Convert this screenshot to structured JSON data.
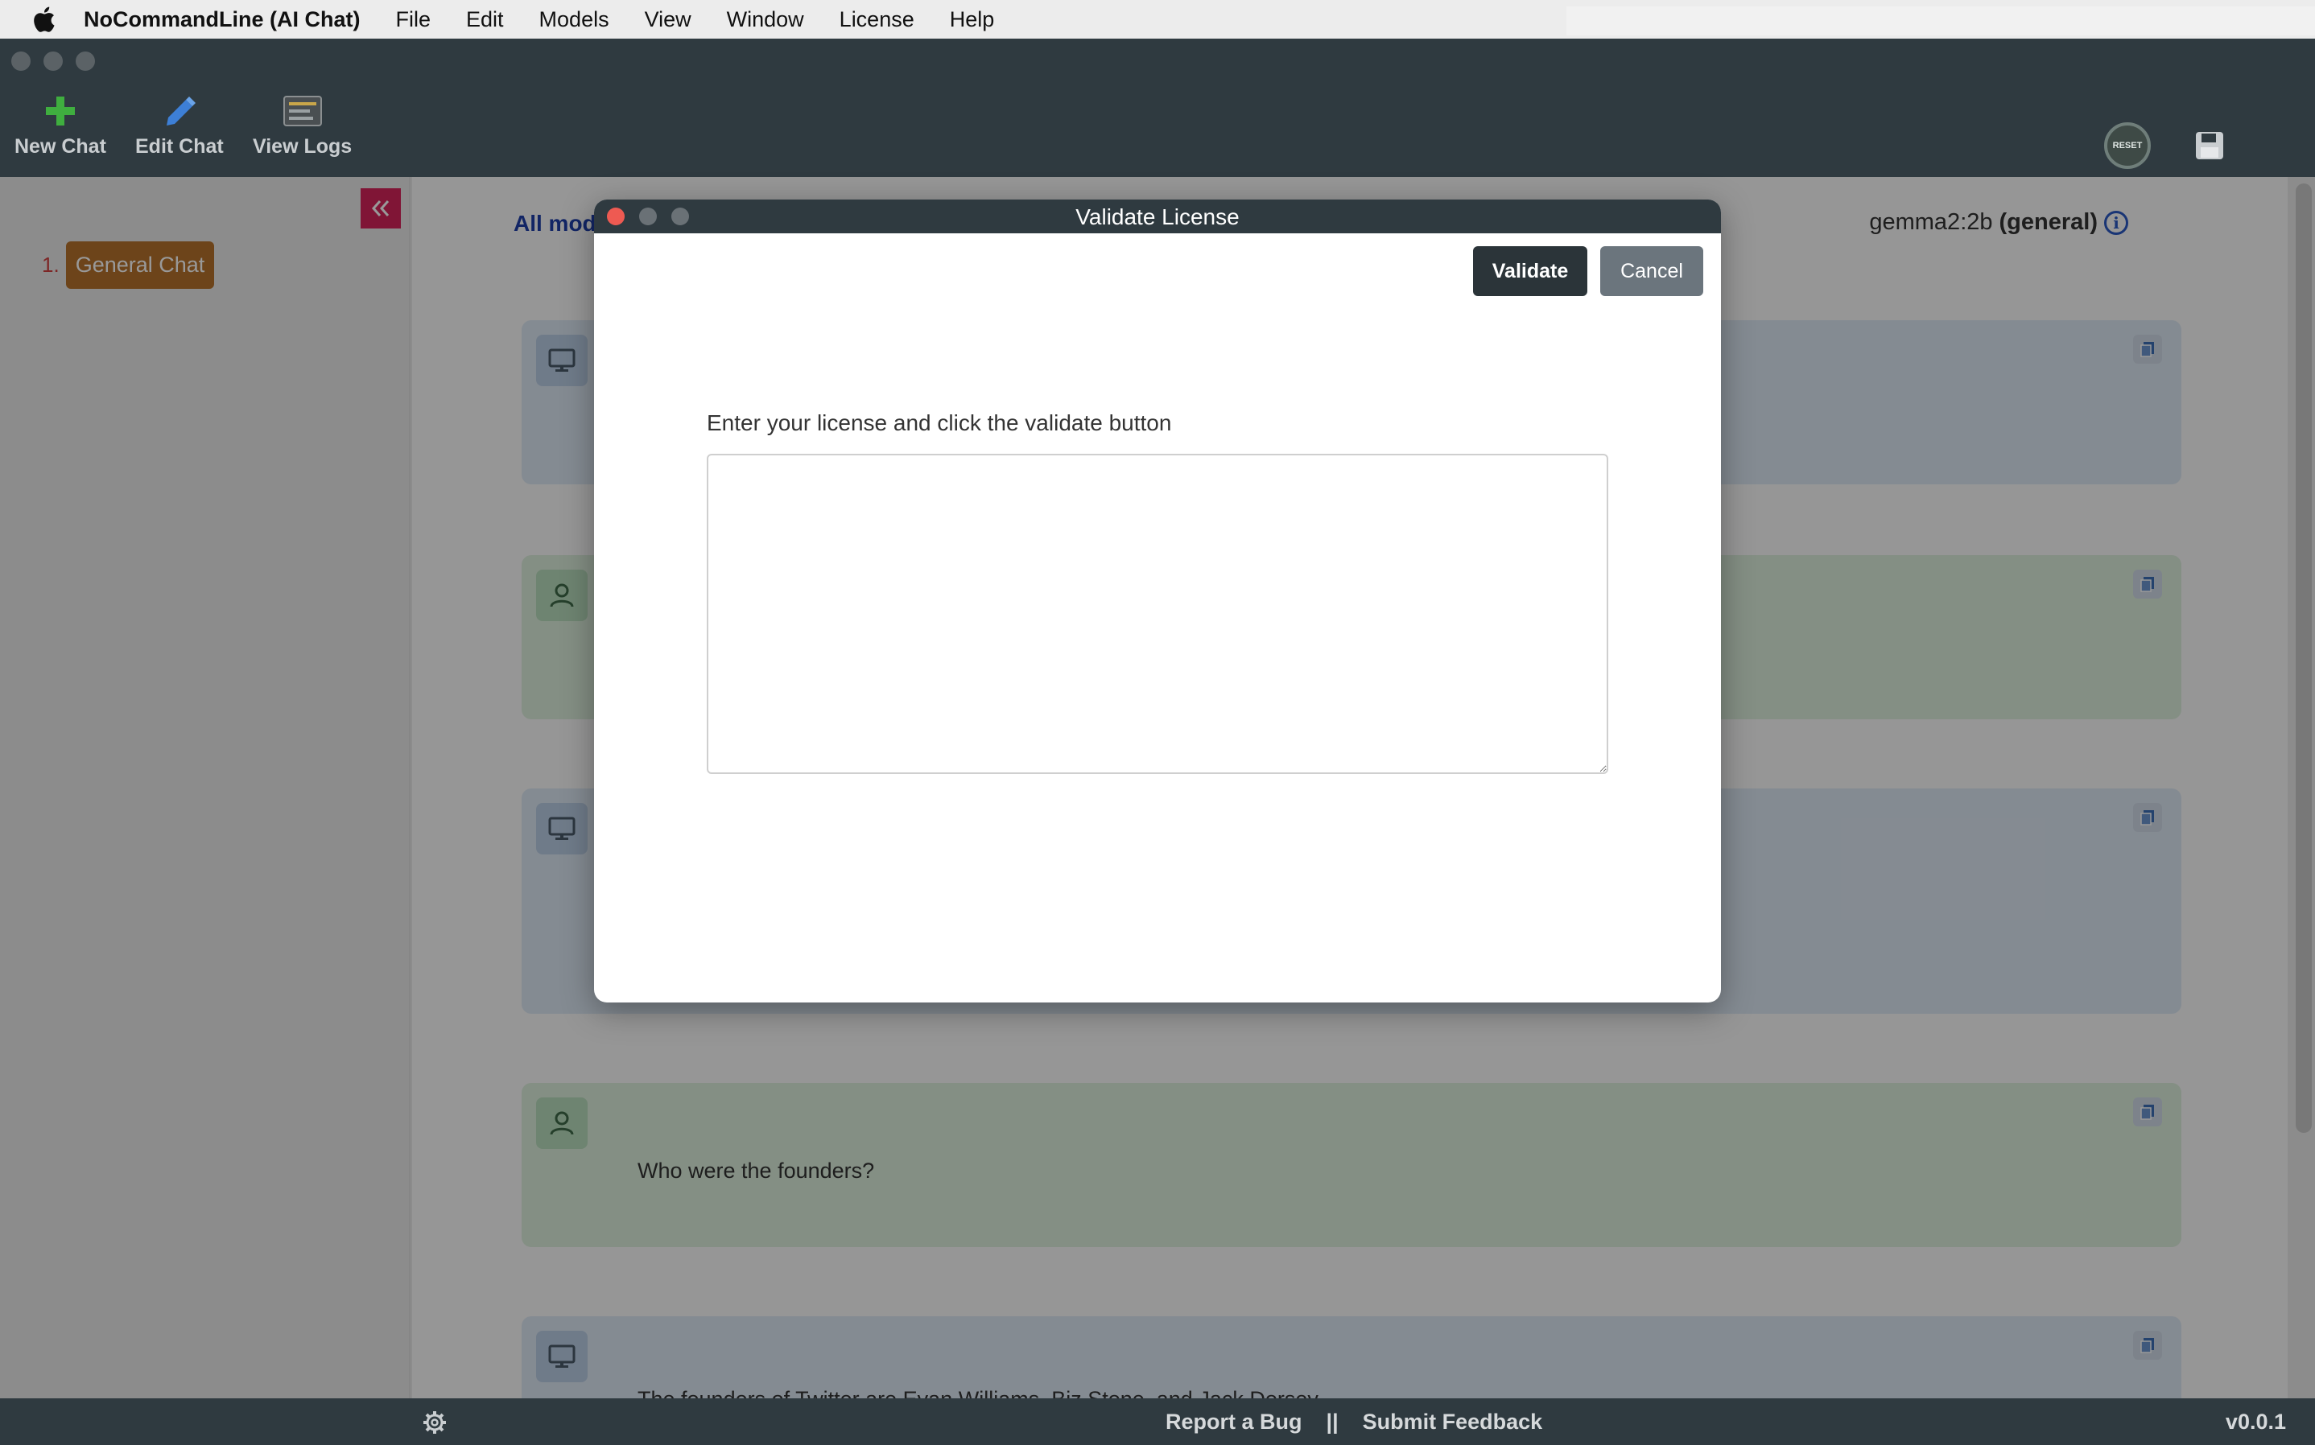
{
  "menubar": {
    "app_name": "NoCommandLine (AI Chat)",
    "items": [
      "File",
      "Edit",
      "Models",
      "View",
      "Window",
      "License",
      "Help"
    ]
  },
  "toolbar": {
    "new_chat": "New Chat",
    "edit_chat": "Edit Chat",
    "view_logs": "View Logs",
    "reset_label": "RESET"
  },
  "sidebar": {
    "chats": [
      {
        "number": "1.",
        "label": "General Chat"
      }
    ]
  },
  "main": {
    "all_models_label": "All mod",
    "model_name": "gemma2:2b",
    "model_type": "(general)",
    "info_glyph": "i",
    "messages": [
      {
        "role": "bot",
        "text": ""
      },
      {
        "role": "user",
        "text": ""
      },
      {
        "role": "bot",
        "text": ""
      },
      {
        "role": "user",
        "text": "Who were the founders?"
      },
      {
        "role": "bot",
        "text": "The founders of Twitter are Evan Williams, Biz Stone, and Jack Dorsey."
      }
    ]
  },
  "statusbar": {
    "report_bug": "Report a Bug",
    "separator": "||",
    "submit_feedback": "Submit Feedback",
    "version": "v0.0.1"
  },
  "modal": {
    "title": "Validate License",
    "validate_label": "Validate",
    "cancel_label": "Cancel",
    "instruction": "Enter your license and click the validate button",
    "license_value": ""
  },
  "colors": {
    "chrome": "#2f3a40",
    "accent_pink": "#d6245a",
    "chat_pill": "#b6722c",
    "bot_bubble": "#dde8f4",
    "user_bubble": "#dcefdc",
    "link_blue": "#1f3fa8"
  },
  "icons": {
    "new_chat": "plus-icon",
    "edit_chat": "pencil-icon",
    "view_logs": "log-viewer-icon",
    "reset": "reset-icon",
    "save": "floppy-disk-icon",
    "collapse": "double-chevron-left-icon",
    "bot": "monitor-icon",
    "user": "person-icon",
    "copy": "copy-icon",
    "settings": "gear-icon",
    "info": "info-icon"
  }
}
